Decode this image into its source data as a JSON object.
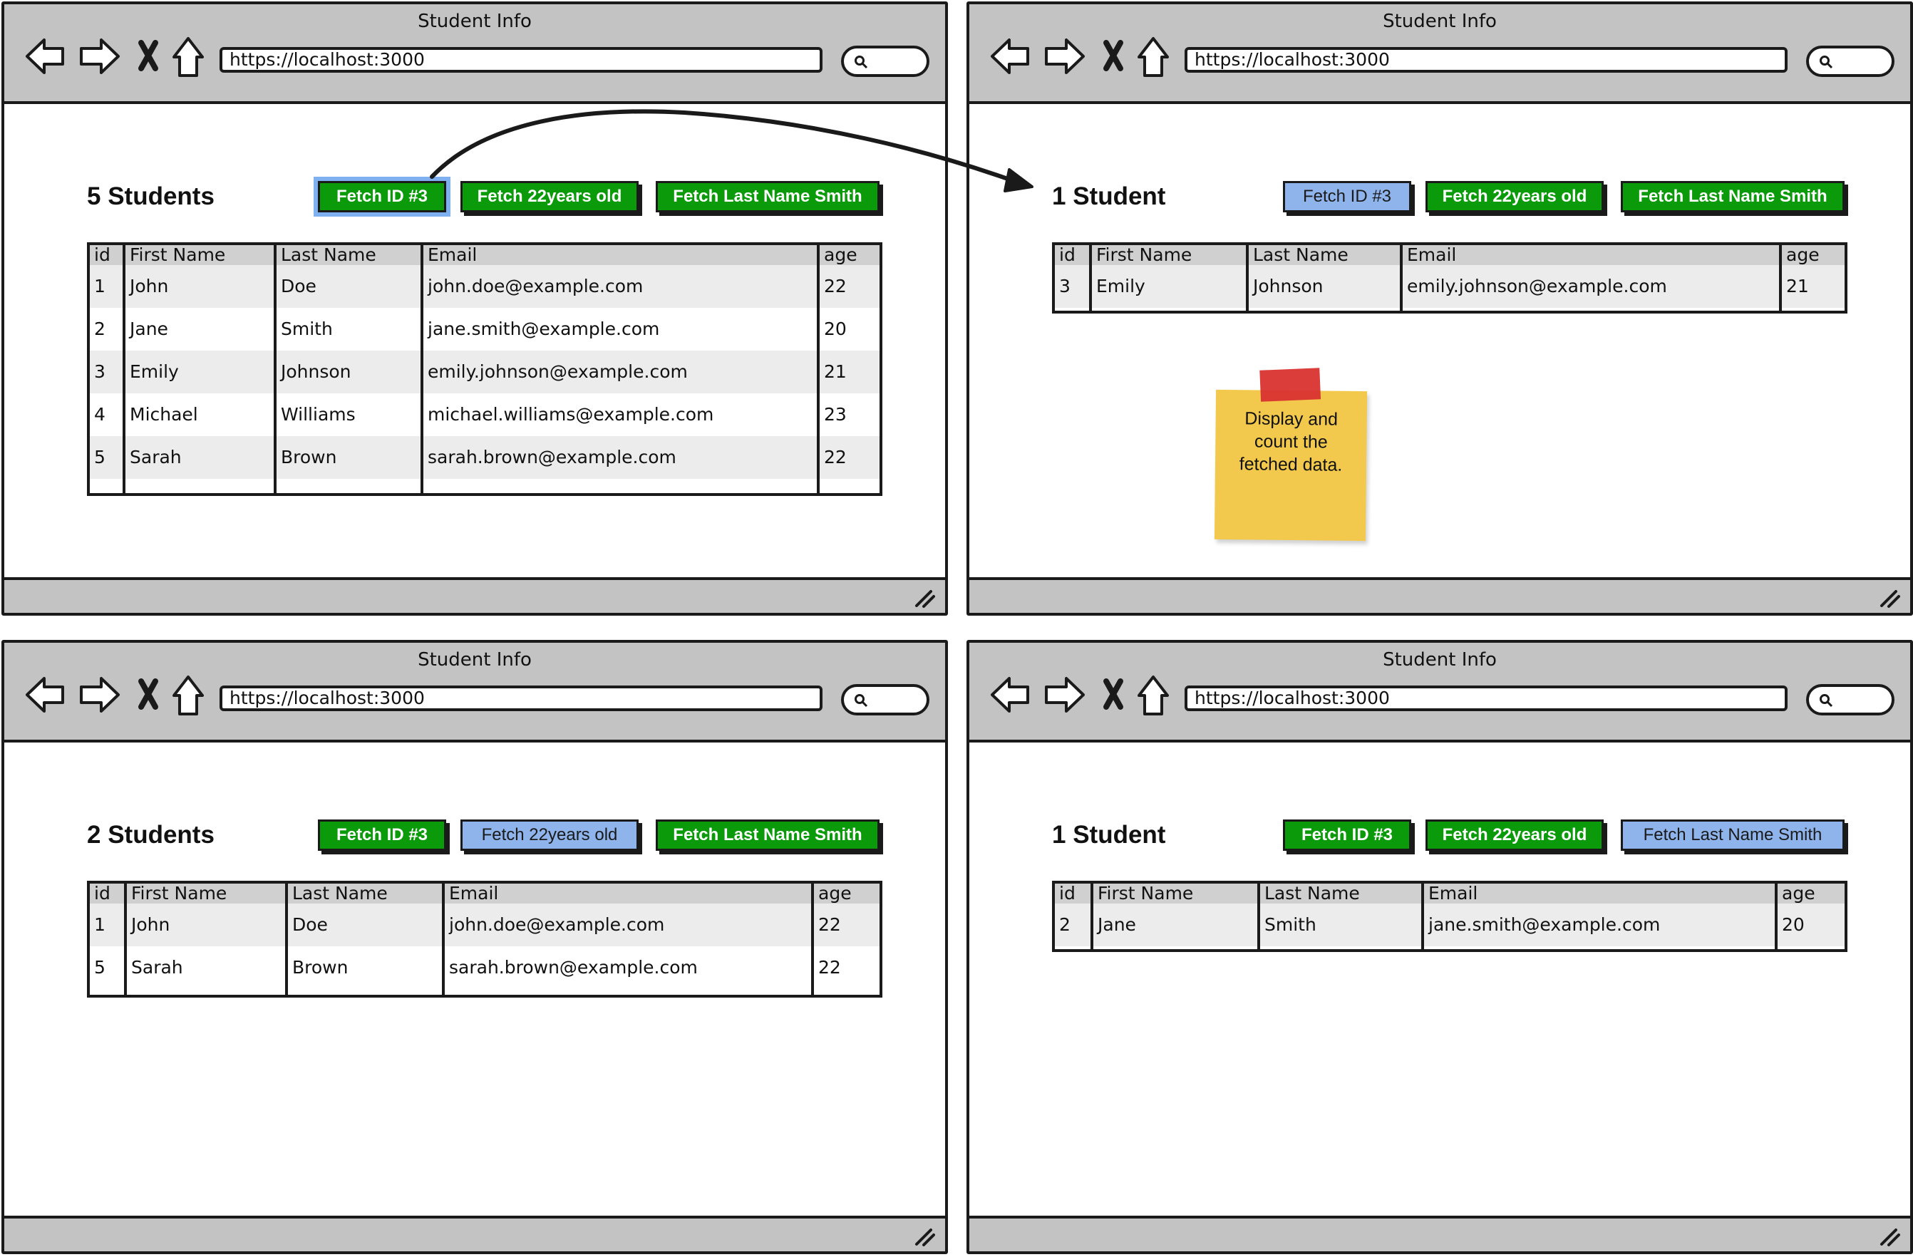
{
  "windows": [
    {
      "title": "Student Info",
      "url": "https://localhost:3000",
      "heading": "5 Students",
      "buttons": [
        {
          "label": "Fetch ID #3",
          "state": "pressed"
        },
        {
          "label": "Fetch 22years old",
          "state": "active"
        },
        {
          "label": "Fetch Last Name Smith",
          "state": "active"
        }
      ],
      "table": {
        "headers": [
          "id",
          "First Name",
          "Last Name",
          "Email",
          "age"
        ],
        "rows": [
          [
            "1",
            "John",
            "Doe",
            "john.doe@example.com",
            "22"
          ],
          [
            "2",
            "Jane",
            "Smith",
            "jane.smith@example.com",
            "20"
          ],
          [
            "3",
            "Emily",
            "Johnson",
            "emily.johnson@example.com",
            "21"
          ],
          [
            "4",
            "Michael",
            "Williams",
            "michael.williams@example.com",
            "23"
          ],
          [
            "5",
            "Sarah",
            "Brown",
            "sarah.brown@example.com",
            "22"
          ]
        ]
      }
    },
    {
      "title": "Student Info",
      "url": "https://localhost:3000",
      "heading": "1 Student",
      "buttons": [
        {
          "label": "Fetch ID #3",
          "state": "disabled"
        },
        {
          "label": "Fetch 22years old",
          "state": "active"
        },
        {
          "label": "Fetch Last Name Smith",
          "state": "active"
        }
      ],
      "table": {
        "headers": [
          "id",
          "First Name",
          "Last Name",
          "Email",
          "age"
        ],
        "rows": [
          [
            "3",
            "Emily",
            "Johnson",
            "emily.johnson@example.com",
            "21"
          ]
        ]
      }
    },
    {
      "title": "Student Info",
      "url": "https://localhost:3000",
      "heading": "2 Students",
      "buttons": [
        {
          "label": "Fetch ID #3",
          "state": "active"
        },
        {
          "label": "Fetch 22years old",
          "state": "disabled"
        },
        {
          "label": "Fetch Last Name Smith",
          "state": "active"
        }
      ],
      "table": {
        "headers": [
          "id",
          "First Name",
          "Last Name",
          "Email",
          "age"
        ],
        "rows": [
          [
            "1",
            "John",
            "Doe",
            "john.doe@example.com",
            "22"
          ],
          [
            "5",
            "Sarah",
            "Brown",
            "sarah.brown@example.com",
            "22"
          ]
        ]
      }
    },
    {
      "title": "Student Info",
      "url": "https://localhost:3000",
      "heading": "1 Student",
      "buttons": [
        {
          "label": "Fetch ID #3",
          "state": "active"
        },
        {
          "label": "Fetch 22years old",
          "state": "active"
        },
        {
          "label": "Fetch Last Name Smith",
          "state": "disabled"
        }
      ],
      "table": {
        "headers": [
          "id",
          "First Name",
          "Last Name",
          "Email",
          "age"
        ],
        "rows": [
          [
            "2",
            "Jane",
            "Smith",
            "jane.smith@example.com",
            "20"
          ]
        ]
      }
    }
  ],
  "sticky_note": {
    "text": "Display and count the fetched data."
  },
  "colors": {
    "chrome": "#c3c3c3",
    "button_active": "#0a9a0a",
    "button_disabled": "#8fb4ec",
    "selection_highlight": "#7fb0f0",
    "sticky": "#f2c94c",
    "sticky_tape": "#d8332f"
  },
  "icons": [
    "back-arrow-icon",
    "forward-arrow-icon",
    "stop-x-icon",
    "home-icon",
    "search-icon",
    "resize-grip-icon"
  ]
}
